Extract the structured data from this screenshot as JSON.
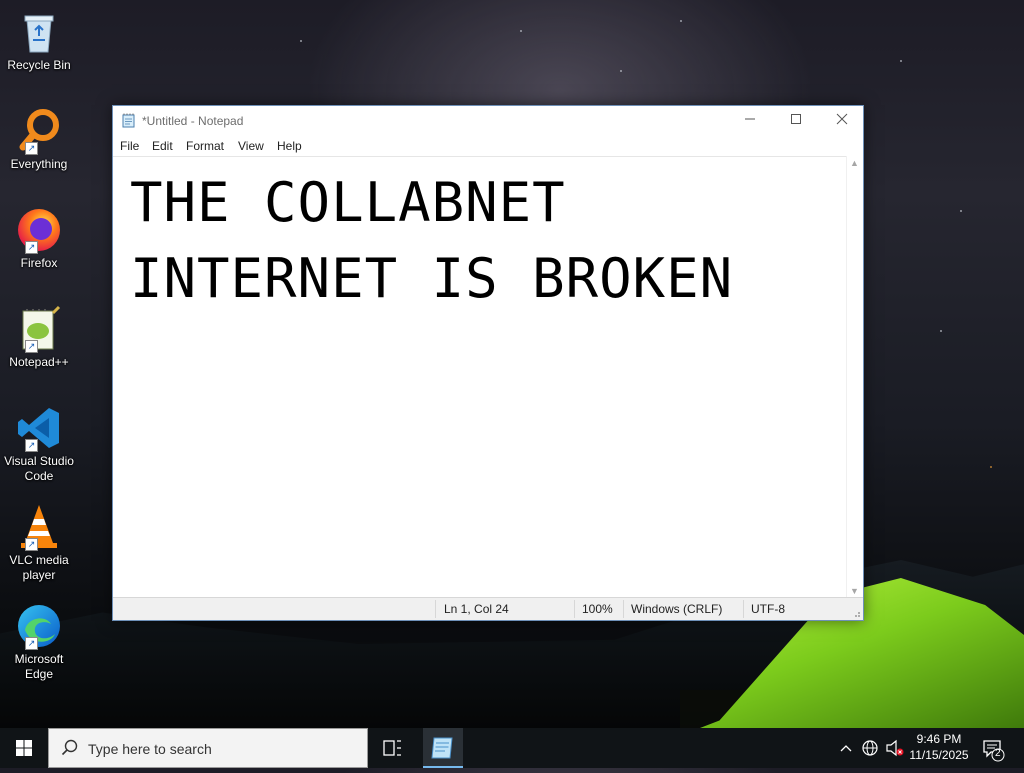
{
  "desktop": {
    "icons": [
      {
        "label": "Recycle Bin"
      },
      {
        "label": "Everything"
      },
      {
        "label": "Firefox"
      },
      {
        "label": "Notepad++"
      },
      {
        "label": "Visual Studio Code"
      },
      {
        "label": "VLC media player"
      },
      {
        "label": "Microsoft Edge"
      }
    ]
  },
  "notepad": {
    "title": "*Untitled - Notepad",
    "menu": [
      "File",
      "Edit",
      "Format",
      "View",
      "Help"
    ],
    "content": "THE COLLABNET\nINTERNET IS BROKEN",
    "status": {
      "position": "Ln 1, Col 24",
      "zoom": "100%",
      "line_ending": "Windows (CRLF)",
      "encoding": "UTF-8"
    }
  },
  "taskbar": {
    "search_placeholder": "Type here to search",
    "time": "9:46 PM",
    "date": "11/15/2025",
    "notification_count": "2"
  },
  "colors": {
    "taskbar": "#101417",
    "accent": "#76b9ed",
    "tent": "#8fdc22"
  }
}
